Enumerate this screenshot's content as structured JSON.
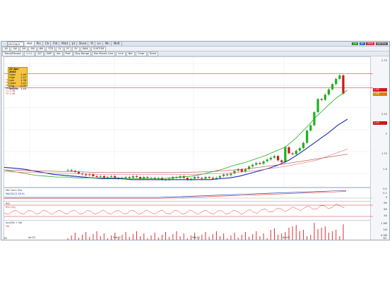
{
  "toolbar": {
    "symbol": "1ZCOA/4",
    "tabs": [
      "Hist",
      "Prc",
      "Ch",
      "Fld",
      "Mrkt",
      "Jd",
      "Shnd",
      "Yt",
      "Ln",
      "Mn",
      "MoR"
    ],
    "buttons": [
      "1D",
      "1W",
      "1M",
      "3M",
      "6M",
      "YTD",
      "1Y",
      "2Y",
      "5Y",
      "MAX",
      "CUSTOM"
    ],
    "study_row": [
      "Trend/Fitness",
      "+/+/-",
      "SLT",
      "BEP",
      "Vol",
      "Prof",
      "Day Range",
      "Bar Mount Line",
      "Line",
      "Bar",
      "Cmpr",
      "Draw"
    ],
    "right_headers": [
      "EH",
      "RT",
      "MSR",
      "MATRIX"
    ]
  },
  "date_box": {
    "title": "22-Apr-2022",
    "rows": [
      {
        "k": "Open",
        "v": "1.46"
      },
      {
        "k": "High",
        "v": "1.47"
      },
      {
        "k": "Low",
        "v": "1.38"
      },
      {
        "k": "Close",
        "v": "1.41"
      },
      {
        "k": "Chg",
        "v": "-0.05"
      },
      {
        "k": "Volume",
        "v": "1.44"
      }
    ]
  },
  "main_legend": [
    "Last Price",
    "MAV (50)",
    "MAV (100)",
    "MAV (20)",
    "T1 2.46",
    "T2 2.46"
  ],
  "ma_panel": {
    "label": "MA Conv. Div.",
    "sub": "MACD(12,26,9)"
  },
  "rsi_panel": {
    "label": "RSI",
    "sub": "RSI (14)"
  },
  "vol_panel": {
    "label": "Acc/Dis + Vol",
    "sub": "Vol"
  },
  "price_tags": {
    "t1": "2.85",
    "t2": "2.48",
    "t3": "2.43"
  },
  "y_axis": [
    "2.75",
    "2.5",
    "2.25",
    "2",
    "1.75",
    "1.5"
  ],
  "ma_axis": [
    "0.2",
    "0.1",
    "0"
  ],
  "rsi_axis": [
    "80",
    "60",
    "40"
  ],
  "vol_axis": [
    "1.5M",
    "1M",
    "0.5M"
  ],
  "x_axis": [
    "Jan22",
    "Feb22",
    "Mar22",
    "Apr22"
  ],
  "footer": {
    "left": "1D",
    "right": "1D"
  },
  "colors": {
    "up": "#19b319",
    "down": "#d0141b",
    "mav50": "#1c2aa6",
    "mav20": "#22b022",
    "band": "#d44"
  },
  "chart_data": {
    "type": "line",
    "candles": [
      1.54,
      1.53,
      1.52,
      1.5,
      1.49,
      1.48,
      1.49,
      1.47,
      1.46,
      1.47,
      1.45,
      1.46,
      1.47,
      1.45,
      1.44,
      1.45,
      1.46,
      1.45,
      1.47,
      1.46,
      1.44,
      1.46,
      1.45,
      1.45,
      1.44,
      1.45,
      1.43,
      1.43,
      1.44,
      1.46,
      1.45,
      1.47,
      1.45,
      1.43,
      1.44,
      1.46,
      1.45,
      1.44,
      1.46,
      1.45,
      1.44,
      1.45,
      1.47,
      1.49,
      1.48,
      1.5,
      1.53,
      1.55,
      1.52,
      1.55,
      1.58,
      1.6,
      1.62,
      1.61,
      1.64,
      1.66,
      1.68,
      1.7,
      1.65,
      1.63,
      1.8,
      1.73,
      1.72,
      1.76,
      1.79,
      1.85,
      1.99,
      2.05,
      2.2,
      2.35,
      2.34,
      2.4,
      2.46,
      2.52,
      2.58,
      2.62,
      2.41
    ],
    "mav50": [
      1.57,
      1.56,
      1.55,
      1.53,
      1.51,
      1.49,
      1.48,
      1.47,
      1.46,
      1.45,
      1.44,
      1.44,
      1.44,
      1.43,
      1.43,
      1.43,
      1.43,
      1.43,
      1.43,
      1.43,
      1.43,
      1.43,
      1.44,
      1.45,
      1.47,
      1.5,
      1.53,
      1.56,
      1.6,
      1.65,
      1.72,
      1.8,
      1.88,
      1.96,
      2.05,
      2.12
    ],
    "mav20": [
      1.54,
      1.52,
      1.5,
      1.48,
      1.47,
      1.46,
      1.46,
      1.45,
      1.45,
      1.45,
      1.45,
      1.45,
      1.44,
      1.44,
      1.44,
      1.44,
      1.45,
      1.46,
      1.47,
      1.49,
      1.52,
      1.55,
      1.59,
      1.62,
      1.66,
      1.7,
      1.75,
      1.8,
      1.9,
      2.02,
      2.15,
      2.26,
      2.37,
      2.45
    ],
    "ylim": [
      1.38,
      2.78
    ]
  }
}
